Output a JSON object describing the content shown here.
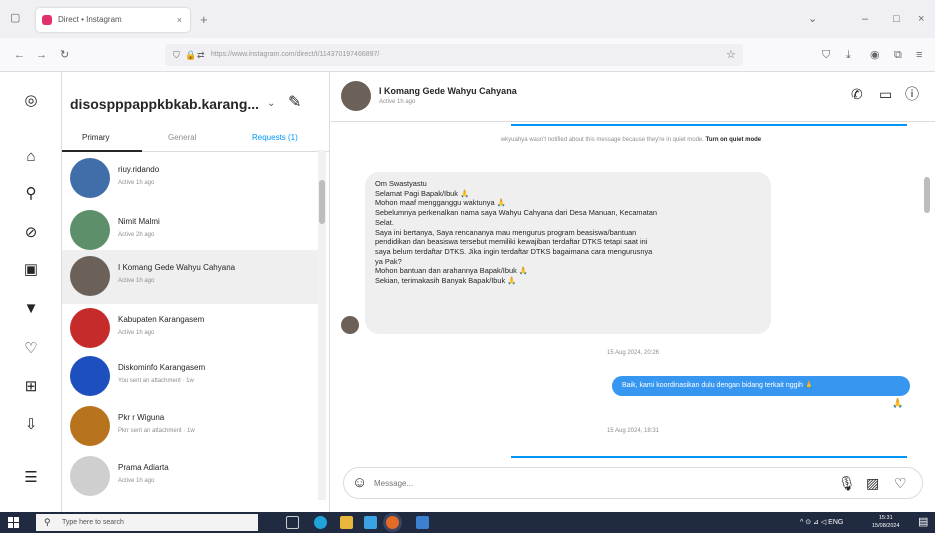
{
  "browser": {
    "tab_title": "Direct • Instagram",
    "tab_close": "×",
    "new_tab": "+",
    "url": "https://www.instagram.com/direct/t/114370197466897/",
    "nav_back": "←",
    "nav_forward": "→",
    "reload": "↻",
    "minimize": "–",
    "maximize": "□",
    "close": "×",
    "menu": "≡",
    "bookmark": "☆"
  },
  "inbox": {
    "account": "disospppappkbkab.karang...",
    "tabs": [
      {
        "label": "Primary"
      },
      {
        "label": "General"
      },
      {
        "label": "Requests (1)"
      }
    ],
    "conversations": [
      {
        "name": "riuy.ridando",
        "sub": "Active 1h ago",
        "avatar_color": "#3f6ea8"
      },
      {
        "name": "Nimit Malmi",
        "sub": "Active 2h ago",
        "avatar_color": "#5c8f6a"
      },
      {
        "name": "I Komang Gede Wahyu Cahyana",
        "sub": "Active 1h ago",
        "avatar_color": "#6b6159"
      },
      {
        "name": "Kabupaten Karangasem",
        "sub": "Active 1h ago",
        "avatar_color": "#c62b2b"
      },
      {
        "name": "Diskominfo Karangasem",
        "sub": "You sent an attachment · 1w",
        "avatar_color": "#1d4fbf"
      },
      {
        "name": "Pkr r Wiguna",
        "sub": "Pkrr sent an attachment · 1w",
        "avatar_color": "#b8731e"
      },
      {
        "name": "Prama Adiarta",
        "sub": "Active 1h ago",
        "avatar_color": "#cfcfcf"
      }
    ]
  },
  "chat": {
    "name": "I Komang Gede Wahyu Cahyana",
    "status": "Active 1h ago",
    "system_note": "wkyuahya wasn't notified about this message because they're in quiet mode.",
    "system_note_link": "Turn on quiet mode",
    "incoming_lines": [
      "Om Swastyastu",
      "Selamat Pagi Bapak/Ibuk 🙏",
      "Mohon maaf mengganggu waktunya 🙏",
      "Sebelumnya perkenalkan nama saya Wahyu Cahyana dari Desa Manuan, Kecamatan",
      "Selat.",
      "Saya ini bertanya, Saya rencananya mau mengurus program beasiswa/bantuan",
      "pendidikan dan beasiswa tersebut memiliki kewajiban terdaftar DTKS tetapi saat ini",
      "saya belum terdaftar DTKS. Jika ingin terdaftar DTKS bagaimana cara mengurusnya",
      "ya Pak?",
      "Mohon bantuan dan arahannya Bapak/Ibuk 🙏",
      "Sekian, terimakasih Banyak Bapak/Ibuk 🙏"
    ],
    "timestamp_1": "15 Aug 2024, 20:26",
    "outgoing": "Baik, kami koordinasikan dulu dengan bidang terkait nggih 🙏",
    "outgoing_emoji": "🙏",
    "timestamp_2": "15 Aug 2024, 18:31",
    "composer_placeholder": "Message..."
  },
  "icons": {
    "instagram": "◎",
    "home": "⌂",
    "search": "⚲",
    "explore": "⊘",
    "reels": "▣",
    "messages": "▼",
    "notifications": "♡",
    "create": "⊞",
    "profile": "⇩",
    "more": "☰",
    "compose": "✎",
    "chevron": "⌄",
    "call": "✆",
    "video": "▭",
    "info": "ⓘ",
    "emoji": "☺",
    "mic": "🎙",
    "gallery": "▨",
    "heart": "♡"
  },
  "taskbar": {
    "search_placeholder": "Type here to search",
    "tray": "^ ⊙ ⊿ ◁ ENG",
    "time": "15:31",
    "date": "15/08/2024"
  },
  "colors": {
    "accent": "#0095f6",
    "outgoing_bubble": "#3797f0",
    "incoming_bubble": "#efefef",
    "taskbar": "#202a40"
  }
}
